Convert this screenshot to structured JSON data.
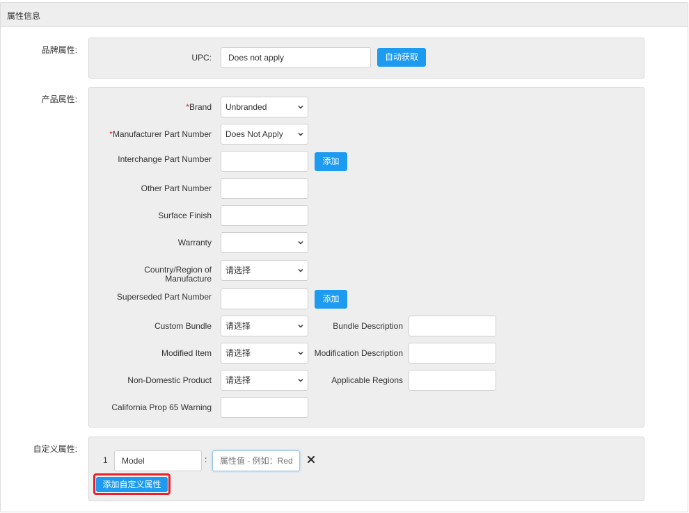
{
  "panel": {
    "title": "属性信息"
  },
  "brand_section": {
    "label": "品牌属性:",
    "upc_label": "UPC:",
    "upc_value": "Does not apply",
    "auto_fetch_button": "自动获取"
  },
  "product_section": {
    "label": "产品属性:",
    "required_mark": "*",
    "brand": {
      "label": "Brand",
      "value": "Unbranded"
    },
    "mpn": {
      "label": "Manufacturer Part Number",
      "value": "Does Not Apply"
    },
    "interchange": {
      "label": "Interchange Part Number",
      "value": "",
      "add_button": "添加"
    },
    "other_part": {
      "label": "Other Part Number",
      "value": ""
    },
    "surface_finish": {
      "label": "Surface Finish",
      "value": ""
    },
    "warranty": {
      "label": "Warranty",
      "value": ""
    },
    "country": {
      "label_line1": "Country/Region of",
      "label_line2": "Manufacture",
      "value": "请选择"
    },
    "superseded": {
      "label": "Superseded Part Number",
      "value": "",
      "add_button": "添加"
    },
    "custom_bundle": {
      "label": "Custom Bundle",
      "value": "请选择"
    },
    "bundle_description": {
      "label": "Bundle Description",
      "value": ""
    },
    "modified_item": {
      "label": "Modified Item",
      "value": "请选择"
    },
    "modification_description": {
      "label": "Modification Description",
      "value": ""
    },
    "non_domestic": {
      "label": "Non-Domestic Product",
      "value": "请选择"
    },
    "applicable_regions": {
      "label": "Applicable Regions",
      "value": ""
    },
    "prop65": {
      "label": "California Prop 65 Warning",
      "value": ""
    }
  },
  "custom_section": {
    "label": "自定义属性:",
    "rows": [
      {
        "index": "1",
        "name": "Model",
        "separator": ":",
        "value": "",
        "value_placeholder": "属性值 - 例如：Red"
      }
    ],
    "add_button": "添加自定义属性"
  },
  "colors": {
    "accent": "#1d9bf0",
    "highlight": "#e8202a",
    "required": "#e2232a"
  }
}
